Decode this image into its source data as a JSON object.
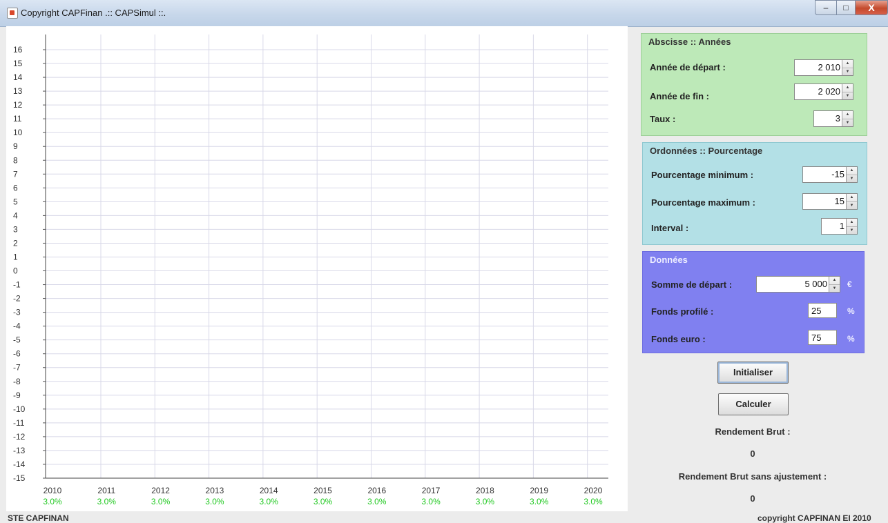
{
  "window": {
    "title": "Copyright CAPFinan .:: CAPSimul ::.",
    "controls": {
      "minimize": "–",
      "maximize": "□",
      "close": "X"
    }
  },
  "chart_data": {
    "type": "line",
    "x_categories": [
      "2010",
      "2011",
      "2012",
      "2013",
      "2014",
      "2015",
      "2016",
      "2017",
      "2018",
      "2019",
      "2020"
    ],
    "rates": [
      "3.0%",
      "3.0%",
      "3.0%",
      "3.0%",
      "3.0%",
      "3.0%",
      "3.0%",
      "3.0%",
      "3.0%",
      "3.0%",
      "3.0%"
    ],
    "rate_color": "#1ec81e",
    "ylim": [
      -15,
      16
    ],
    "y_ticks": [
      16,
      15,
      14,
      13,
      12,
      11,
      10,
      9,
      8,
      7,
      6,
      5,
      4,
      3,
      2,
      1,
      0,
      -1,
      -2,
      -3,
      -4,
      -5,
      -6,
      -7,
      -8,
      -9,
      -10,
      -11,
      -12,
      -13,
      -14,
      -15
    ],
    "grid": true,
    "series": []
  },
  "abscisse": {
    "title": "Abscisse :: Années",
    "start_label": "Année de départ :",
    "start_value": "2 010",
    "end_label": "Année de fin :",
    "end_value": "2 020",
    "rate_label": "Taux :",
    "rate_value": "3"
  },
  "ordonnees": {
    "title": "Ordonnées :: Pourcentage",
    "min_label": "Pourcentage minimum :",
    "min_value": "-15",
    "max_label": "Pourcentage maximum :",
    "max_value": "15",
    "interval_label": "Interval :",
    "interval_value": "1"
  },
  "donnees": {
    "title": "Données",
    "sum_label": "Somme de départ :",
    "sum_value": "5 000",
    "sum_unit": "€",
    "profile_label": "Fonds profilé :",
    "profile_value": "25",
    "profile_unit": "%",
    "euro_label": "Fonds euro :",
    "euro_value": "75",
    "euro_unit": "%"
  },
  "actions": {
    "init_label": "Initialiser",
    "calc_label": "Calculer"
  },
  "results": {
    "gross_label": "Rendement Brut :",
    "gross_value": "0",
    "gross_unadj_label": "Rendement Brut sans ajustement :",
    "gross_unadj_value": "0"
  },
  "status": {
    "left": "STE CAPFINAN",
    "right": "copyright CAPFINAN EI 2010"
  },
  "colors": {
    "panel_abscisse": "#bde9b8",
    "panel_ordonnees": "#b3e0e6",
    "panel_donnees": "#8080f0",
    "grid": "#d8d8e8"
  }
}
